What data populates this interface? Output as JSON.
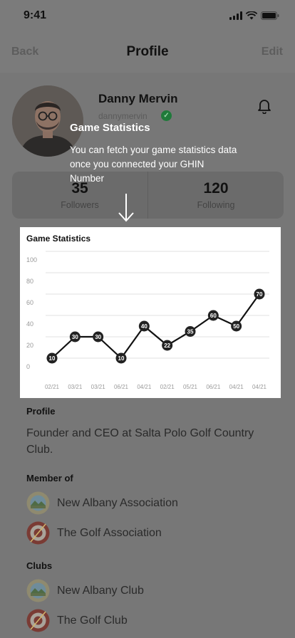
{
  "status_bar": {
    "time": "9:41"
  },
  "nav": {
    "back_label": "Back",
    "title": "Profile",
    "edit_label": "Edit"
  },
  "profile": {
    "name": "Danny Mervin",
    "handle": "dannymervin"
  },
  "tooltip": {
    "title": "Game Statistics",
    "body": "You can fetch your game statistics data once you connected your GHIN Number"
  },
  "stats": {
    "followers": {
      "value": "35",
      "label": "Followers"
    },
    "following": {
      "value": "120",
      "label": "Following"
    }
  },
  "chart_data": {
    "type": "line",
    "title": "Game Statistics",
    "categories": [
      "02/21",
      "03/21",
      "03/21",
      "06/21",
      "04/21",
      "02/21",
      "05/21",
      "06/21",
      "04/21",
      "04/21"
    ],
    "values": [
      10,
      30,
      30,
      10,
      40,
      22,
      35,
      50,
      40,
      70
    ],
    "point_labels": [
      "10",
      "30",
      "30",
      "10",
      "40",
      "22",
      "35",
      "60",
      "50",
      "70"
    ],
    "ylim": [
      0,
      100
    ],
    "yticks": [
      0,
      20,
      40,
      60,
      80,
      100
    ],
    "grid": true,
    "legend": "none",
    "xlabel": "",
    "ylabel": ""
  },
  "about": {
    "label": "Profile",
    "text": "Founder and CEO at Salta Polo Golf Country Club."
  },
  "member_of": {
    "label": "Member of",
    "items": [
      {
        "name": "New Albany Association",
        "icon": "association-crest-icon"
      },
      {
        "name": "The Golf Association",
        "icon": "golf-crest-icon"
      }
    ]
  },
  "clubs": {
    "label": "Clubs",
    "items": [
      {
        "name": "New Albany Club",
        "icon": "club-crest-icon"
      },
      {
        "name": "The Golf Club",
        "icon": "golf-club-crest-icon"
      }
    ]
  },
  "colors": {
    "overlay": "#7b7b7b",
    "chart_line": "#111111",
    "verified": "#1f7a3a",
    "card": "#6b6b6b"
  }
}
